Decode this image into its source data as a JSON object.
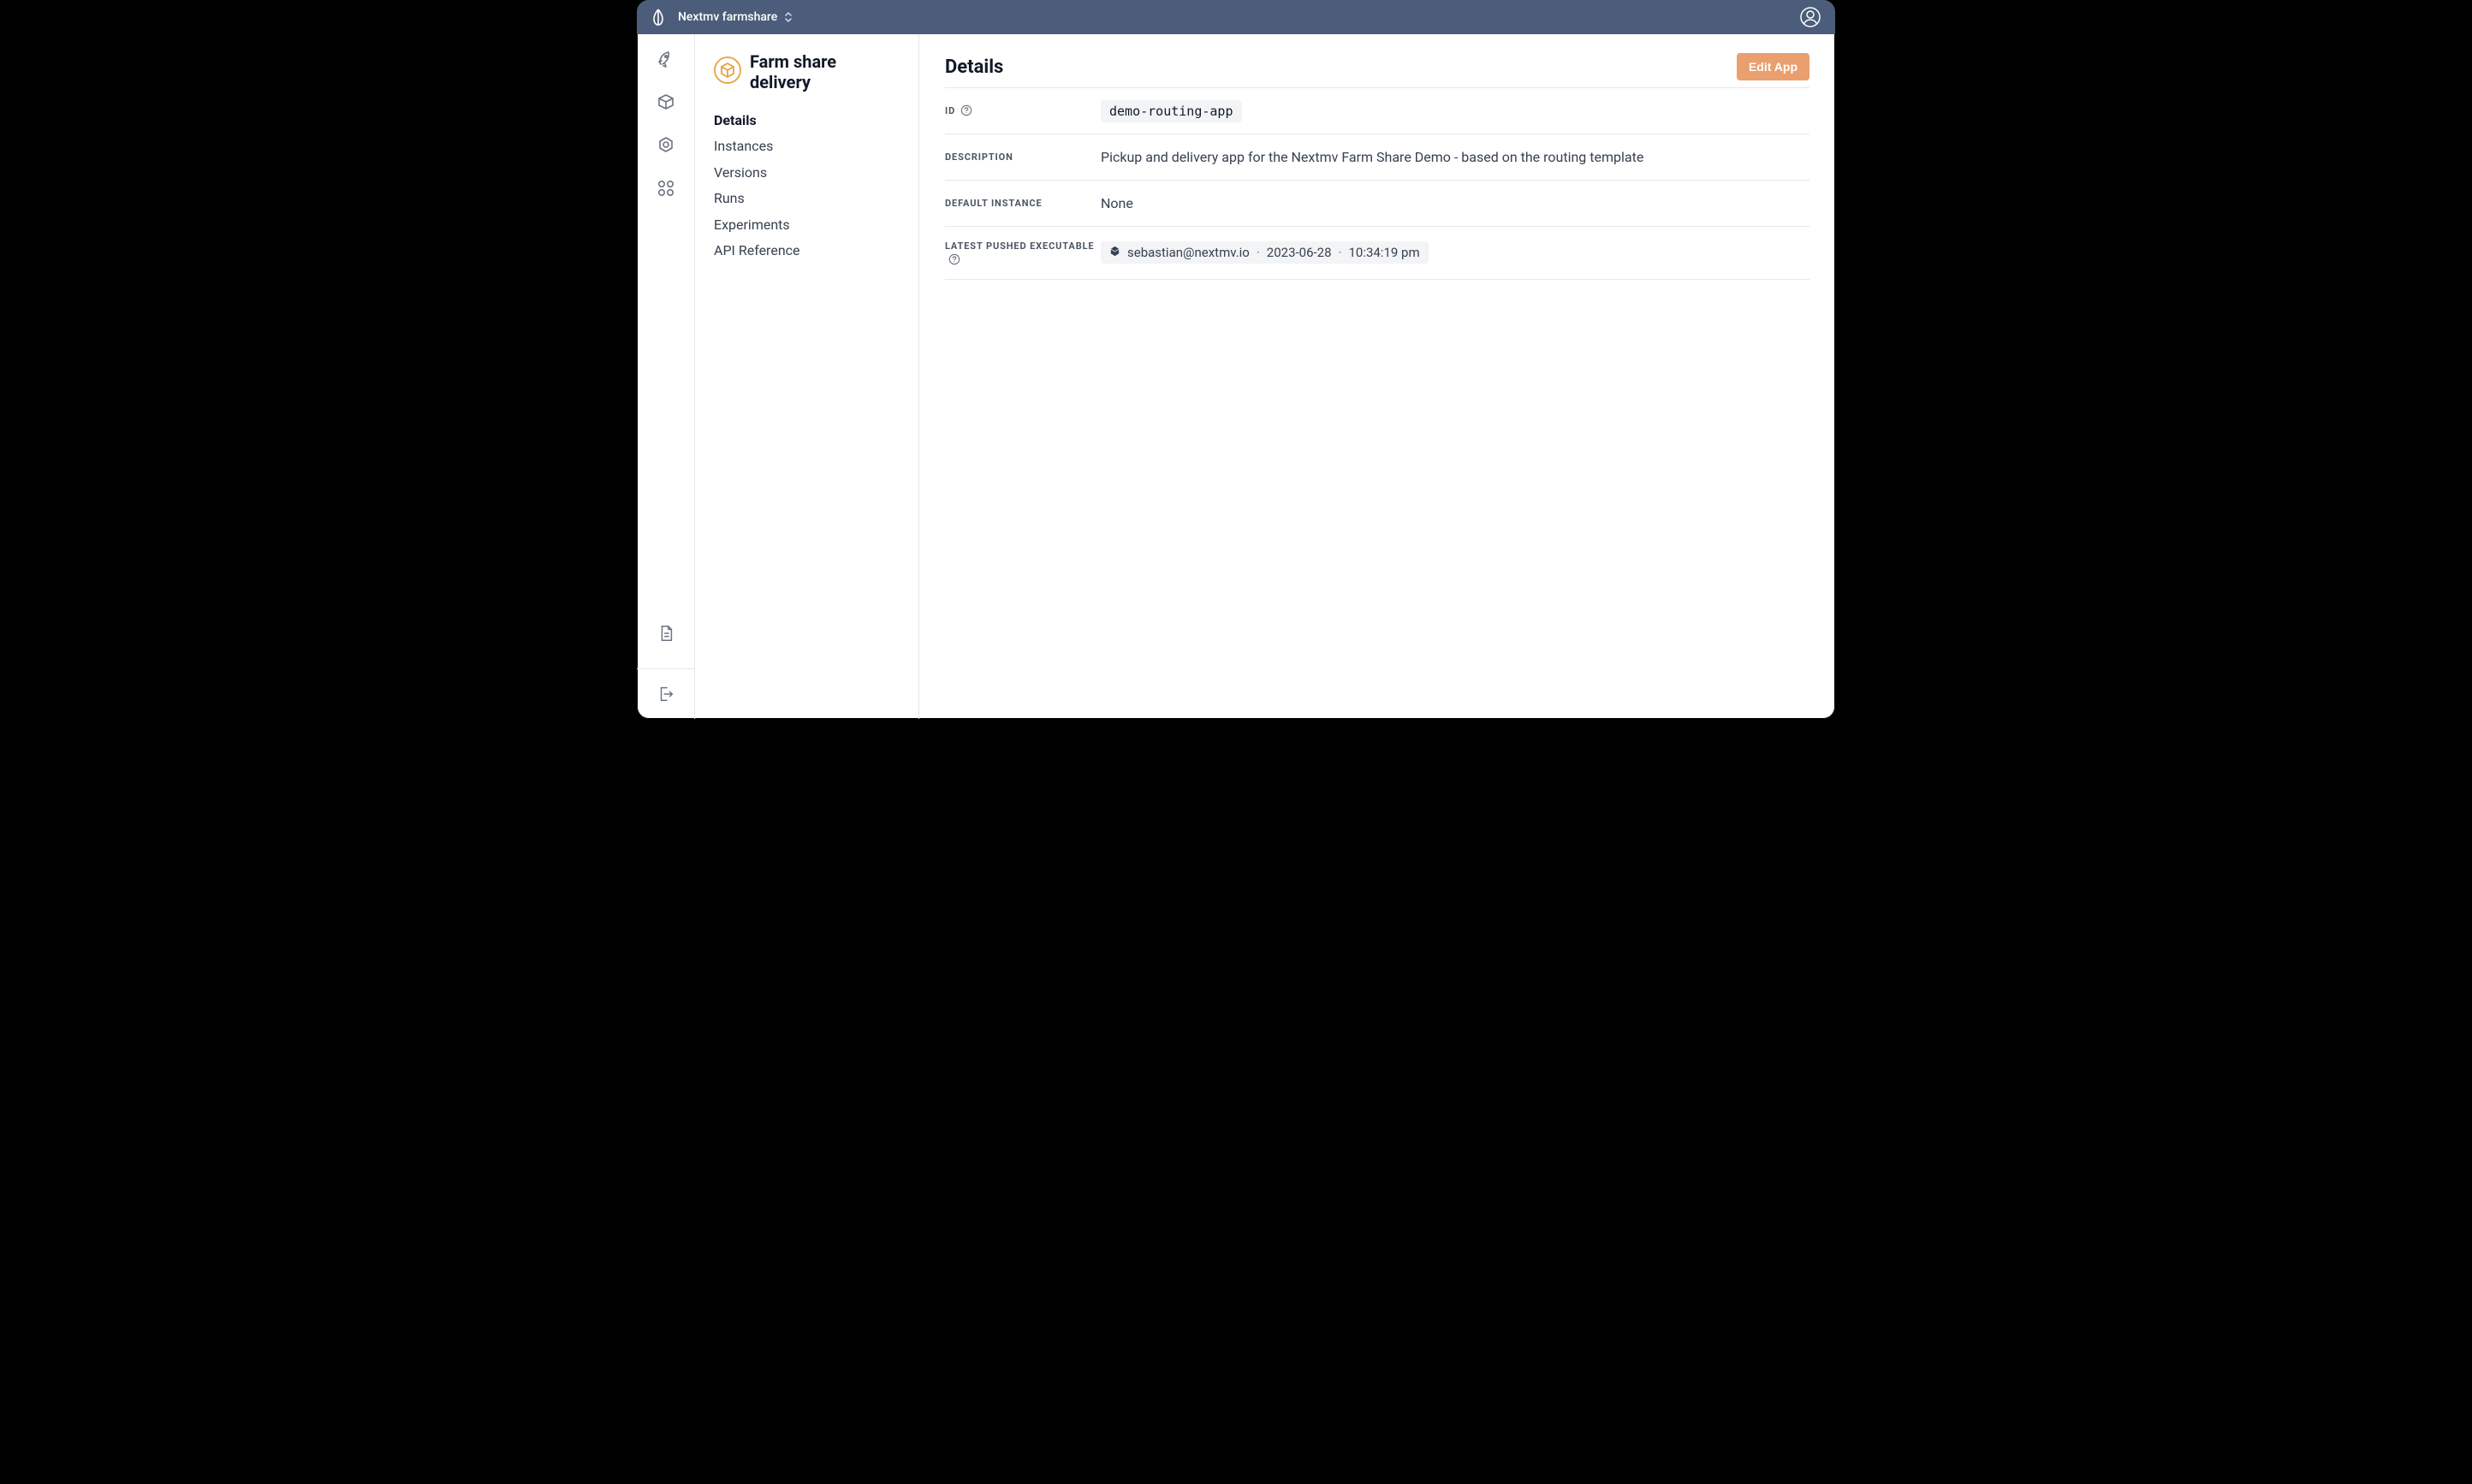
{
  "header": {
    "org_name": "Nextmv farmshare"
  },
  "sidebar": {
    "app_title": "Farm share delivery",
    "nav": [
      {
        "label": "Details",
        "active": true
      },
      {
        "label": "Instances",
        "active": false
      },
      {
        "label": "Versions",
        "active": false
      },
      {
        "label": "Runs",
        "active": false
      },
      {
        "label": "Experiments",
        "active": false
      },
      {
        "label": "API Reference",
        "active": false
      }
    ]
  },
  "main": {
    "title": "Details",
    "edit_button": "Edit App",
    "rows": {
      "id": {
        "label": "ID",
        "value": "demo-routing-app"
      },
      "description": {
        "label": "Description",
        "value": "Pickup and delivery app for the Nextmv Farm Share Demo - based on the routing template"
      },
      "default_instance": {
        "label": "Default Instance",
        "value": "None"
      },
      "latest_exec": {
        "label": "Latest Pushed Executable",
        "user": "sebastian@nextmv.io",
        "date": "2023-06-28",
        "time": "10:34:19 pm"
      }
    }
  }
}
